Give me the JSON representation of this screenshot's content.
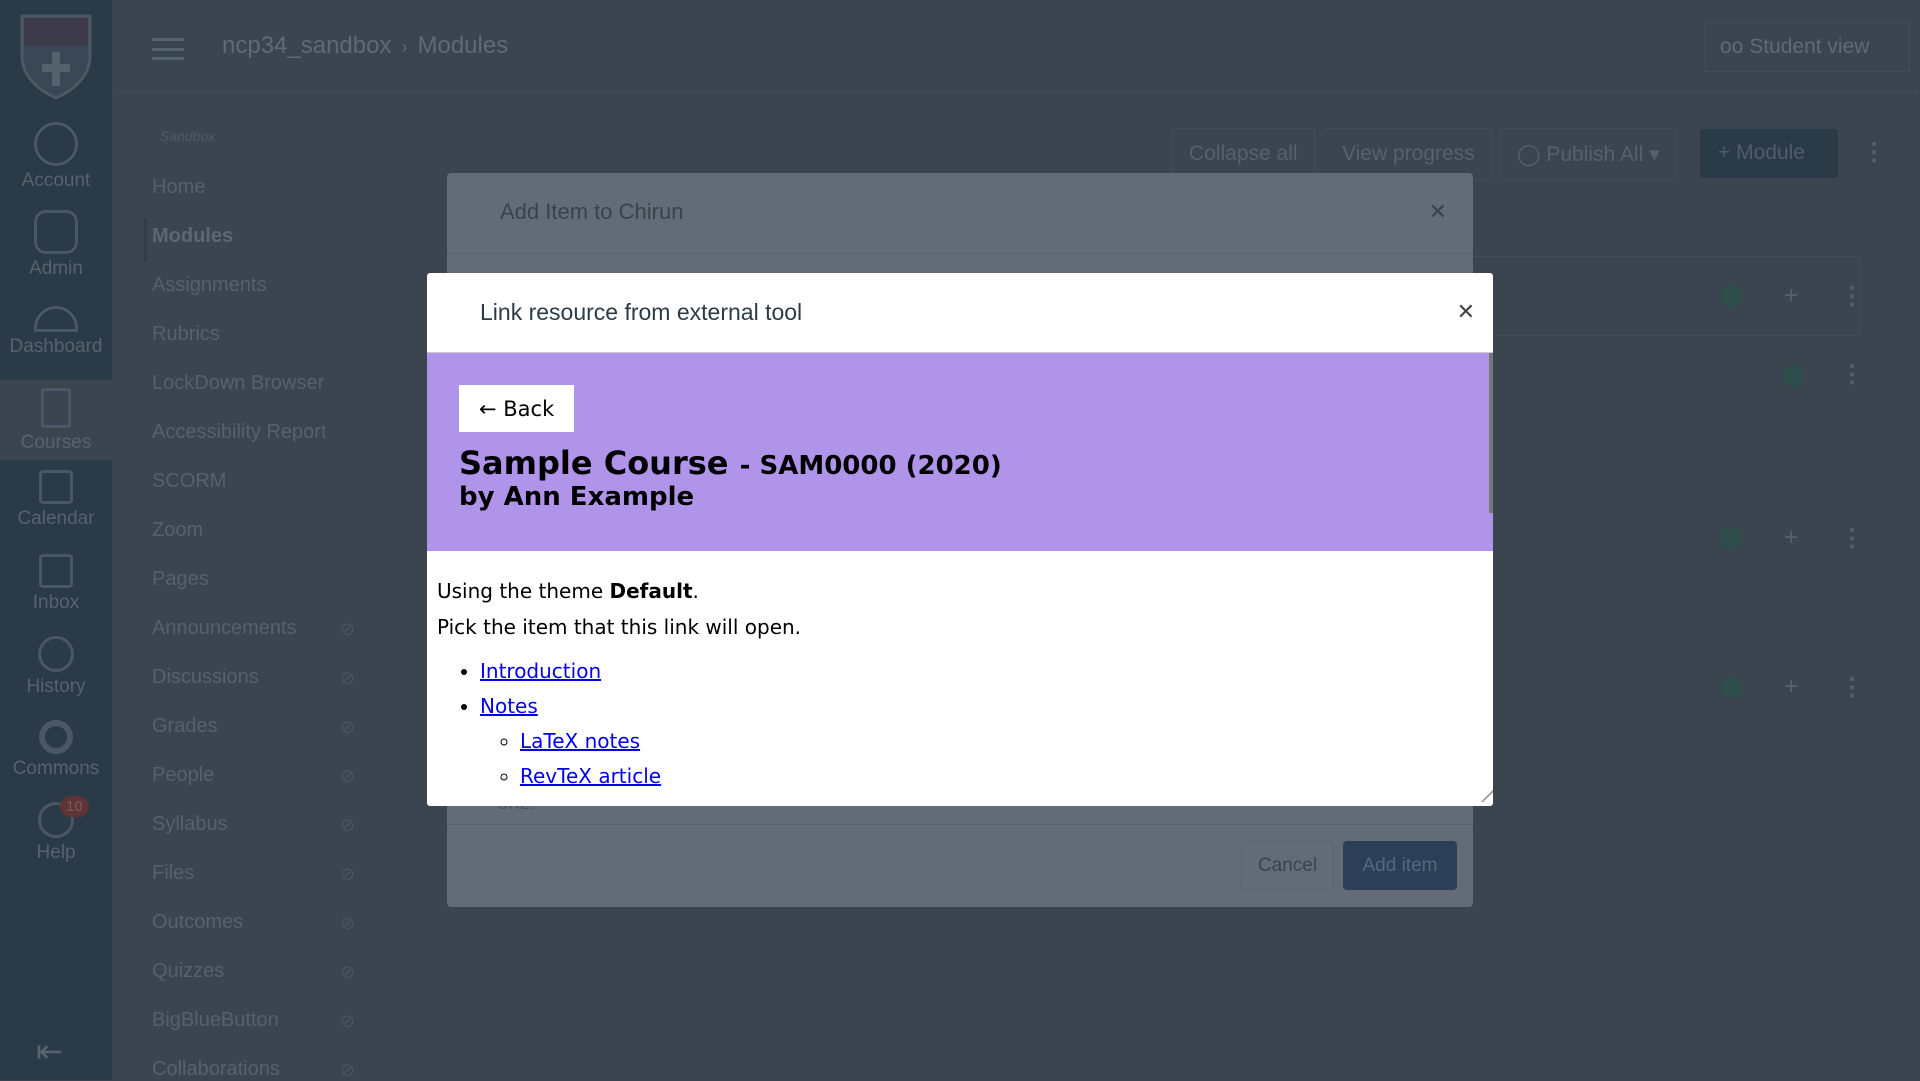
{
  "global_nav": {
    "items": [
      {
        "label": "Account",
        "icon": "account-icon"
      },
      {
        "label": "Admin",
        "icon": "admin-icon"
      },
      {
        "label": "Dashboard",
        "icon": "dashboard-icon"
      },
      {
        "label": "Courses",
        "icon": "courses-icon"
      },
      {
        "label": "Calendar",
        "icon": "calendar-icon"
      },
      {
        "label": "Inbox",
        "icon": "inbox-icon"
      },
      {
        "label": "History",
        "icon": "history-icon"
      },
      {
        "label": "Commons",
        "icon": "commons-icon"
      },
      {
        "label": "Help",
        "icon": "help-icon",
        "badge": "10"
      }
    ]
  },
  "header": {
    "course": "ncp34_sandbox",
    "page": "Modules",
    "student_view": "Student view"
  },
  "course_nav": {
    "term": "Sandbox",
    "items": [
      "Home",
      "Modules",
      "Assignments",
      "Rubrics",
      "LockDown Browser",
      "Accessibility Report",
      "SCORM",
      "Zoom",
      "Pages",
      "Announcements",
      "Discussions",
      "Grades",
      "People",
      "Syllabus",
      "Files",
      "Outcomes",
      "Quizzes",
      "BigBlueButton",
      "Collaborations"
    ],
    "active": "Modules"
  },
  "toolbar": {
    "collapse_all": "Collapse all",
    "view_progress": "View progress",
    "publish_all": "Publish All",
    "add_module": "+ Module"
  },
  "add_item_dialog": {
    "title": "Add Item to Chirun",
    "url_label": "URL:",
    "cancel": "Cancel",
    "add": "Add item"
  },
  "link_dialog": {
    "title": "Link resource from external tool",
    "back": "← Back",
    "course_title": "Sample Course",
    "course_code": "- SAM0000 (2020)",
    "author": "by Ann Example",
    "theme_prefix": "Using the theme ",
    "theme": "Default",
    "theme_suffix": ".",
    "instruction": "Pick the item that this link will open.",
    "items": [
      {
        "label": "Introduction"
      },
      {
        "label": "Notes",
        "children": [
          "LaTeX notes",
          "RevTeX article"
        ]
      }
    ],
    "header_color": "#b094ea"
  }
}
